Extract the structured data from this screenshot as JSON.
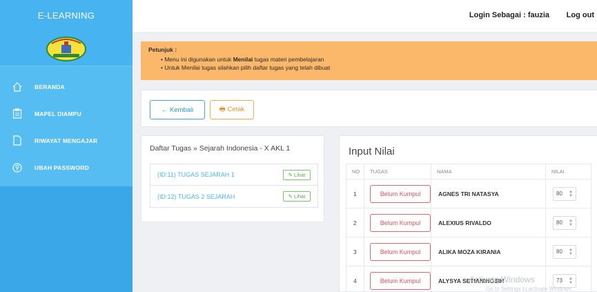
{
  "sidebar": {
    "brand": "E-LEARNING",
    "items": [
      {
        "label": "BERANDA",
        "icon": "home-icon"
      },
      {
        "label": "MAPEL DIAMPU",
        "icon": "clipboard-icon"
      },
      {
        "label": "RIWAYAT MENGAJAR",
        "icon": "document-icon"
      },
      {
        "label": "UBAH PASSWORD",
        "icon": "key-icon"
      }
    ]
  },
  "header": {
    "login_text": "Login Sebagai : fauzia",
    "logout": "Log out"
  },
  "notice": {
    "title": "Petunjuk :",
    "line1_pre": "Menu ini digunakan untuk ",
    "line1_bold": "Menilai",
    "line1_post": " tugas materi pembelajaran",
    "line2": "Untuk Menilai tugas silahkan pilih daftar tugas yang telah dibuat"
  },
  "actions": {
    "back": "← Kembali",
    "print": "🖶 Cetak"
  },
  "tasks": {
    "heading": "Daftar Tugas » Sejarah Indonesia - X AKL 1",
    "items": [
      {
        "name": "(ID:11) TUGAS SEJARAH 1",
        "action": "✎ Lihat"
      },
      {
        "name": "(ID:12) TUGAS 2 SEJARAH",
        "action": "✎ Lihat"
      }
    ]
  },
  "nilai": {
    "heading": "Input Nilai",
    "columns": [
      "NO",
      "TUGAS",
      "NAMA",
      "NILAI"
    ],
    "rows": [
      {
        "no": "1",
        "tugas": "Belum Kumpul",
        "nama": "AGNES TRI NATASYA",
        "nilai": "80"
      },
      {
        "no": "2",
        "tugas": "Belum Kumpul",
        "nama": "ALEXIUS RIVALDO",
        "nilai": "80"
      },
      {
        "no": "3",
        "tugas": "Belum Kumpul",
        "nama": "ALIKA MOZA KIRANIA",
        "nilai": "80"
      },
      {
        "no": "4",
        "tugas": "Belum Kumpul",
        "nama": "ALYSYA SETIANINGSIH",
        "nilai": "73"
      }
    ]
  },
  "watermark": {
    "line1": "Activate Windows",
    "line2": "Go to Settings to activate Windows."
  },
  "colors": {
    "sidebar": "#3aa7e8",
    "notice": "#fbb86a",
    "link": "#4db6e9",
    "danger": "#e0535b"
  }
}
